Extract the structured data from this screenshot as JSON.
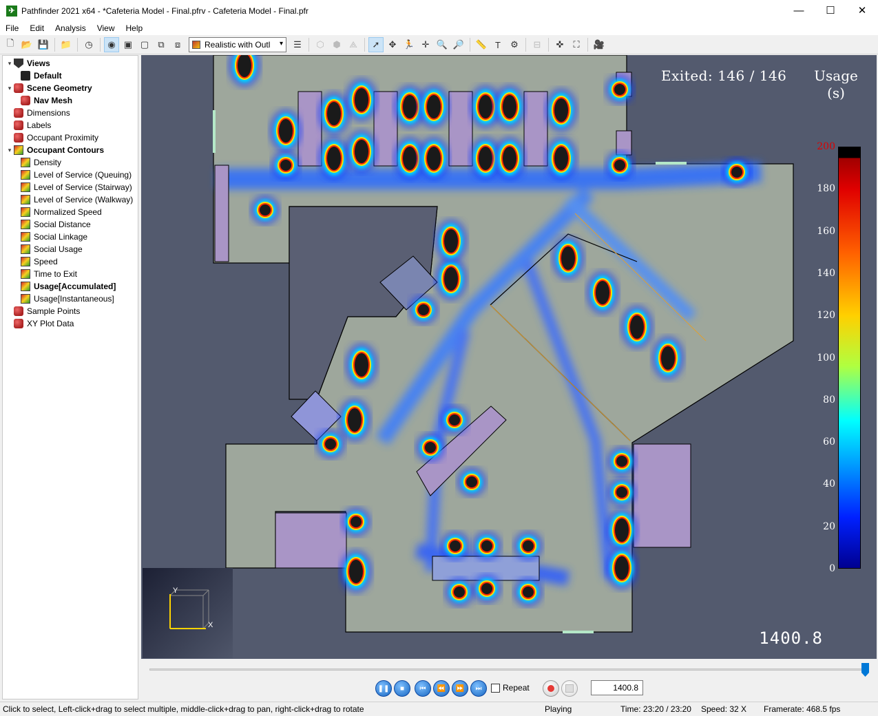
{
  "window": {
    "title": "Pathfinder 2021 x64 - *Cafeteria Model - Final.pfrv - Cafeteria Model - Final.pfr",
    "minimize": "—",
    "maximize": "☐",
    "close": "✕"
  },
  "menu": [
    "File",
    "Edit",
    "Analysis",
    "View",
    "Help"
  ],
  "toolbar": {
    "render_mode": "Realistic with Outl"
  },
  "tree": [
    {
      "label": "Views",
      "icon": "views-icon",
      "bold": true,
      "expanded": true
    },
    {
      "label": "Default",
      "icon": "camera-icon",
      "bold": true
    },
    {
      "label": "Scene Geometry",
      "icon": "geometry-icon",
      "bold": true,
      "expanded": true
    },
    {
      "label": "Nav Mesh",
      "icon": "nav-mesh-icon",
      "bold": true
    },
    {
      "label": "Dimensions",
      "icon": "dimensions-icon"
    },
    {
      "label": "Labels",
      "icon": "labels-icon"
    },
    {
      "label": "Occupant Proximity",
      "icon": "proximity-icon"
    },
    {
      "label": "Occupant Contours",
      "icon": "contours-icon",
      "bold": true,
      "expanded": true
    },
    {
      "label": "Density",
      "icon": "contour-icon"
    },
    {
      "label": "Level of Service (Queuing)",
      "icon": "contour-icon"
    },
    {
      "label": "Level of Service (Stairway)",
      "icon": "contour-icon"
    },
    {
      "label": "Level of Service (Walkway)",
      "icon": "contour-icon"
    },
    {
      "label": "Normalized Speed",
      "icon": "contour-icon"
    },
    {
      "label": "Social Distance",
      "icon": "contour-icon"
    },
    {
      "label": "Social Linkage",
      "icon": "contour-icon"
    },
    {
      "label": "Social Usage",
      "icon": "contour-icon"
    },
    {
      "label": "Speed",
      "icon": "contour-icon"
    },
    {
      "label": "Time to Exit",
      "icon": "contour-icon"
    },
    {
      "label": "Usage[Accumulated]",
      "icon": "contour-icon",
      "bold": true
    },
    {
      "label": "Usage[Instantaneous]",
      "icon": "contour-icon"
    },
    {
      "label": "Sample Points",
      "icon": "sample-points-icon"
    },
    {
      "label": "XY Plot Data",
      "icon": "xy-plot-icon"
    }
  ],
  "viewport": {
    "exited_label": "Exited:",
    "exited_value": "146 / 146",
    "legend_title_1": "Usage",
    "legend_title_2": "(s)",
    "legend_ticks": [
      "200",
      "180",
      "160",
      "140",
      "120",
      "100",
      "80",
      "60",
      "40",
      "20",
      "0"
    ],
    "axis_y": "Y",
    "axis_x": "X",
    "sim_time": "1400.8"
  },
  "playback": {
    "position": 1.0,
    "repeat_label": "Repeat",
    "time_value": "1400.8"
  },
  "status": {
    "hint": "Click to select, Left-click+drag to select multiple, middle-click+drag to pan, right-click+drag to rotate",
    "state": "Playing",
    "time": "Time: 23:20 / 23:20",
    "speed": "Speed: 32 X",
    "framerate": "Framerate: 468.5 fps"
  }
}
